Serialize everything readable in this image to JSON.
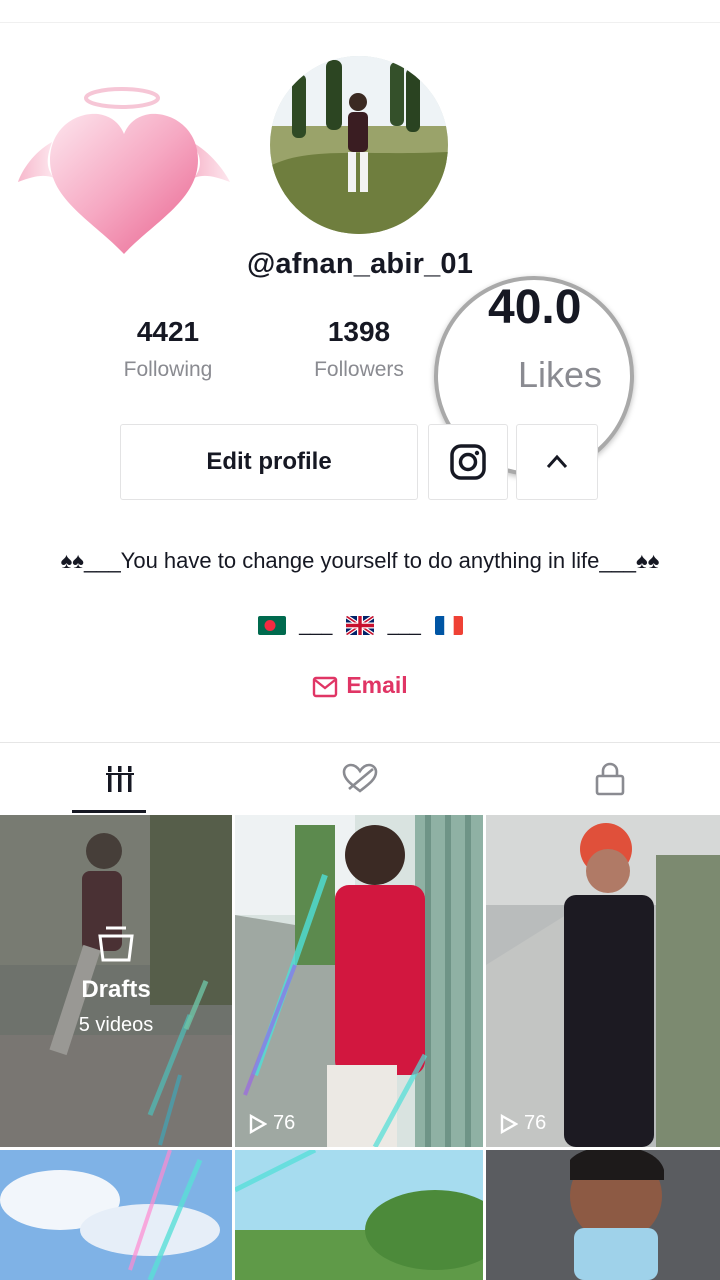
{
  "profile": {
    "username": "@afnan_abir_01",
    "stats": [
      {
        "value": "4421",
        "label": "Following"
      },
      {
        "value": "1398",
        "label": "Followers"
      }
    ],
    "likes_zoom": {
      "value": "40.0",
      "label": "Likes"
    },
    "edit_button": "Edit profile",
    "bio_line1": "♠♠___You have to change yourself to do anything in life___♠♠",
    "flag_sep1": "___",
    "flag_sep2": "___",
    "email_label": "Email"
  },
  "tabs": [
    {
      "icon": "grid-icon",
      "active": true
    },
    {
      "icon": "hidden-likes-icon",
      "active": false
    },
    {
      "icon": "lock-icon",
      "active": false
    }
  ],
  "drafts": {
    "title": "Drafts",
    "subtitle": "5 videos"
  },
  "videos": [
    {
      "views": "76"
    },
    {
      "views": "76"
    }
  ],
  "colors": {
    "accent": "#e03565",
    "text": "#161823",
    "muted": "#8a8b91"
  }
}
